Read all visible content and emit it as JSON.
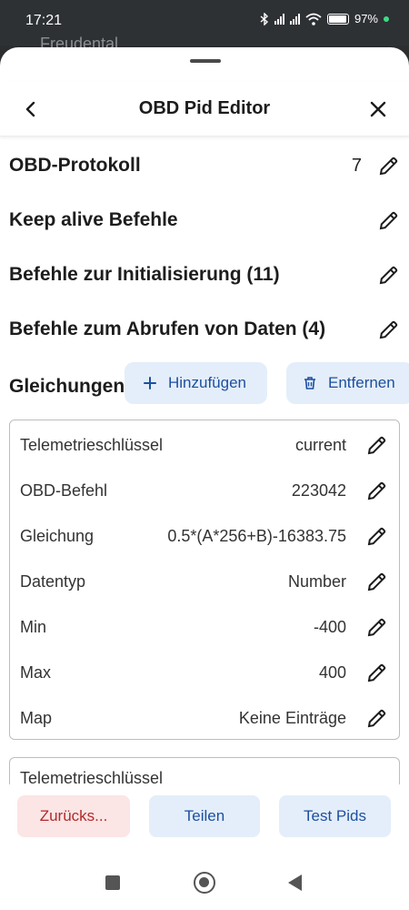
{
  "status_bar": {
    "time": "17:21",
    "battery": "97%",
    "background_text": "Freudental"
  },
  "header": {
    "title": "OBD Pid Editor"
  },
  "sections": [
    {
      "label": "OBD-Protokoll",
      "value": "7"
    },
    {
      "label": "Keep alive Befehle",
      "value": ""
    },
    {
      "label": "Befehle zur Initialisierung (11)",
      "value": ""
    },
    {
      "label": "Befehle zum Abrufen von Daten (4)",
      "value": ""
    }
  ],
  "equations": {
    "label": "Gleichungen",
    "add_label": "Hinzufügen",
    "remove_label": "Entfernen"
  },
  "card": {
    "rows": [
      {
        "key": "Telemetrieschlüssel",
        "value": "current"
      },
      {
        "key": "OBD-Befehl",
        "value": "223042"
      },
      {
        "key": "Gleichung",
        "value": "0.5*(A*256+B)-16383.75"
      },
      {
        "key": "Datentyp",
        "value": "Number"
      },
      {
        "key": "Min",
        "value": "-400"
      },
      {
        "key": "Max",
        "value": "400"
      },
      {
        "key": "Map",
        "value": "Keine Einträge"
      }
    ]
  },
  "card2": {
    "first_key_partial": "Telemetrieschlüssel"
  },
  "footer": {
    "reset_label": "Zurücks...",
    "share_label": "Teilen",
    "test_label": "Test Pids"
  },
  "colors": {
    "accent": "#1d4f9e",
    "accent_bg": "#e4eefa",
    "danger": "#b22a2a",
    "danger_bg": "#fbe5e5"
  }
}
